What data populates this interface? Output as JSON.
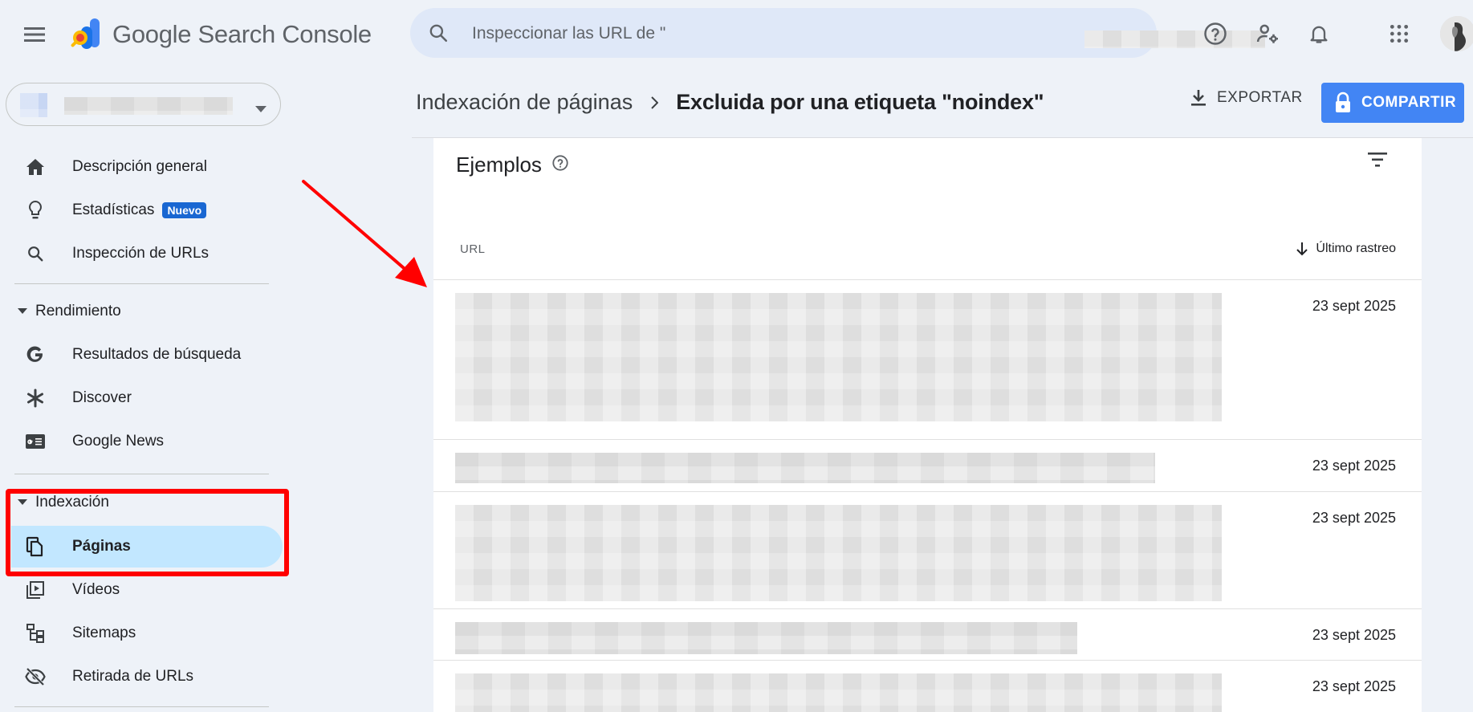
{
  "header": {
    "app_title": "Google Search Console",
    "search_placeholder": "Inspeccionar las URL de \"",
    "search_suffix": "'"
  },
  "nav": {
    "top_items": [
      {
        "label": "Descripción general",
        "icon": "home-icon"
      },
      {
        "label": "Estadísticas",
        "icon": "lightbulb-icon",
        "badge": "Nuevo"
      },
      {
        "label": "Inspección de URLs",
        "icon": "search-icon"
      }
    ],
    "rendimiento": {
      "title": "Rendimiento",
      "items": [
        {
          "label": "Resultados de búsqueda",
          "icon": "google-g-icon"
        },
        {
          "label": "Discover",
          "icon": "asterisk-icon"
        },
        {
          "label": "Google News",
          "icon": "google-news-icon"
        }
      ]
    },
    "indexacion": {
      "title": "Indexación",
      "items": [
        {
          "label": "Páginas",
          "icon": "pages-icon",
          "active": true
        },
        {
          "label": "Vídeos",
          "icon": "video-icon"
        },
        {
          "label": "Sitemaps",
          "icon": "sitemap-icon"
        },
        {
          "label": "Retirada de URLs",
          "icon": "visibility-off-icon"
        }
      ]
    }
  },
  "breadcrumb": {
    "parent": "Indexación de páginas",
    "separator": ">",
    "current": "Excluida por una etiqueta \"noindex\""
  },
  "toolbar": {
    "export_label": "EXPORTAR",
    "share_label": "COMPARTIR"
  },
  "card": {
    "title": "Ejemplos",
    "columns": {
      "url": "URL",
      "last_crawl": "Último rastreo"
    },
    "rows": [
      {
        "date": "23 sept 2025"
      },
      {
        "date": "23 sept 2025"
      },
      {
        "date": "23 sept 2025"
      },
      {
        "date": "23 sept 2025"
      },
      {
        "date": "23 sept 2025"
      }
    ]
  },
  "colors": {
    "accent": "#4285f4",
    "active_nav": "#c2e7ff",
    "badge": "#1967d2",
    "highlight": "#ff0000"
  }
}
